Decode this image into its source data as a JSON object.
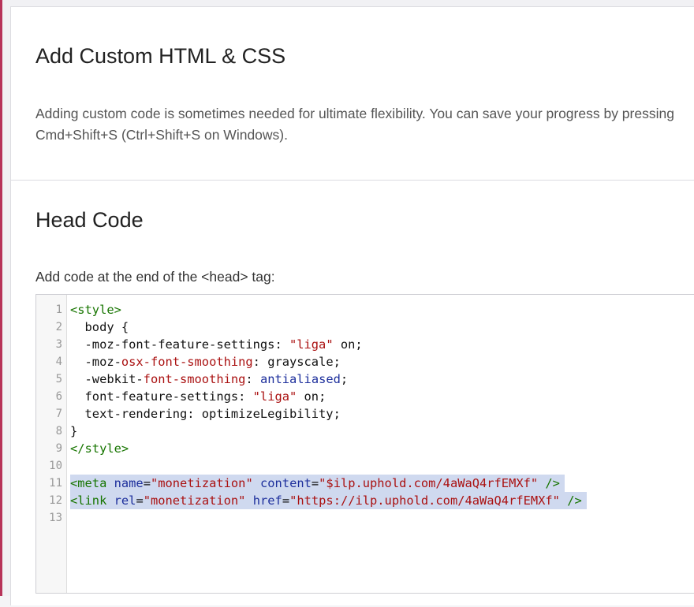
{
  "section": {
    "title": "Add Custom HTML & CSS",
    "description": "Adding custom code is sometimes needed for ultimate flexibility. You can save your progress by pressing Cmd+Shift+S (Ctrl+Shift+S on Windows)."
  },
  "head_code": {
    "title": "Head Code",
    "hint": "Add code at the end of the <head> tag:",
    "lines": [
      {
        "n": "1",
        "tokens": [
          {
            "t": "<style>",
            "c": "t-tag"
          }
        ]
      },
      {
        "n": "2",
        "tokens": [
          {
            "t": "  body {",
            "c": ""
          }
        ]
      },
      {
        "n": "3",
        "tokens": [
          {
            "t": "  -moz-font-feature-settings: ",
            "c": ""
          },
          {
            "t": "\"liga\"",
            "c": "t-str"
          },
          {
            "t": " on;",
            "c": ""
          }
        ]
      },
      {
        "n": "4",
        "tokens": [
          {
            "t": "  -moz-",
            "c": ""
          },
          {
            "t": "osx-font-smoothing",
            "c": "t-prop"
          },
          {
            "t": ": grayscale;",
            "c": ""
          }
        ]
      },
      {
        "n": "5",
        "tokens": [
          {
            "t": "  -webkit-",
            "c": ""
          },
          {
            "t": "font-smoothing",
            "c": "t-prop"
          },
          {
            "t": ": ",
            "c": ""
          },
          {
            "t": "antialiased",
            "c": "t-kw"
          },
          {
            "t": ";",
            "c": ""
          }
        ]
      },
      {
        "n": "6",
        "tokens": [
          {
            "t": "  font-feature-settings: ",
            "c": ""
          },
          {
            "t": "\"liga\"",
            "c": "t-str"
          },
          {
            "t": " on;",
            "c": ""
          }
        ]
      },
      {
        "n": "7",
        "tokens": [
          {
            "t": "  text-rendering: optimizeLegibility;",
            "c": ""
          }
        ]
      },
      {
        "n": "8",
        "tokens": [
          {
            "t": "}",
            "c": ""
          }
        ]
      },
      {
        "n": "9",
        "tokens": [
          {
            "t": "</style>",
            "c": "t-tag"
          }
        ]
      },
      {
        "n": "10",
        "tokens": []
      },
      {
        "n": "11",
        "sel": true,
        "tokens": [
          {
            "t": "<meta",
            "c": "t-tag"
          },
          {
            "t": " ",
            "c": ""
          },
          {
            "t": "name",
            "c": "t-attr"
          },
          {
            "t": "=",
            "c": ""
          },
          {
            "t": "\"monetization\"",
            "c": "t-str"
          },
          {
            "t": " ",
            "c": ""
          },
          {
            "t": "content",
            "c": "t-attr"
          },
          {
            "t": "=",
            "c": ""
          },
          {
            "t": "\"$ilp.uphold.com/4aWaQ4rfEMXf\"",
            "c": "t-str"
          },
          {
            "t": " />",
            "c": "t-tag"
          }
        ]
      },
      {
        "n": "12",
        "sel": true,
        "tokens": [
          {
            "t": "<link",
            "c": "t-tag"
          },
          {
            "t": " ",
            "c": ""
          },
          {
            "t": "rel",
            "c": "t-attr"
          },
          {
            "t": "=",
            "c": ""
          },
          {
            "t": "\"monetization\"",
            "c": "t-str"
          },
          {
            "t": " ",
            "c": ""
          },
          {
            "t": "href",
            "c": "t-attr"
          },
          {
            "t": "=",
            "c": ""
          },
          {
            "t": "\"https://ilp.uphold.com/4aWaQ4rfEMXf\"",
            "c": "t-str"
          },
          {
            "t": " />",
            "c": "t-tag"
          }
        ]
      },
      {
        "n": "13",
        "tokens": []
      }
    ]
  },
  "colors": {
    "tag": "#177500",
    "attr": "#1d2f9c",
    "string": "#aa1111",
    "selection": "#cfd9ef"
  }
}
